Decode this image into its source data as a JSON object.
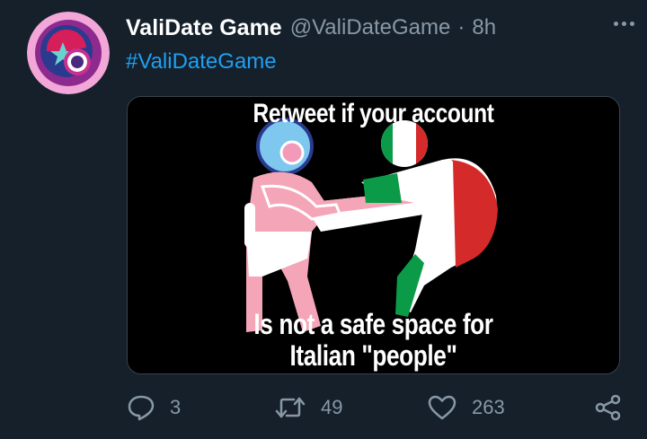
{
  "tweet": {
    "author_name": "ValiDate Game",
    "author_handle": "@ValiDateGame",
    "separator": "·",
    "time_ago": "8h",
    "hashtag": "#ValiDateGame",
    "more_icon": "more-horizontal-icon",
    "avatar_colors": [
      "#f2a7d8",
      "#8e2a8e",
      "#d61e5a",
      "#2a3a8e",
      "#6ad0d0"
    ]
  },
  "media": {
    "caption_top": "Retweet if your account",
    "caption_bottom_line1": "Is not a safe space for",
    "caption_bottom_line2": "Italian \"people\""
  },
  "actions": {
    "reply": {
      "icon": "reply-icon",
      "count": "3"
    },
    "retweet": {
      "icon": "retweet-icon",
      "count": "49"
    },
    "like": {
      "icon": "heart-icon",
      "count": "263"
    },
    "share": {
      "icon": "share-icon"
    }
  },
  "colors": {
    "background": "#15202b",
    "secondary_text": "#8899a6",
    "link": "#1da1f2",
    "border": "#38444d"
  }
}
